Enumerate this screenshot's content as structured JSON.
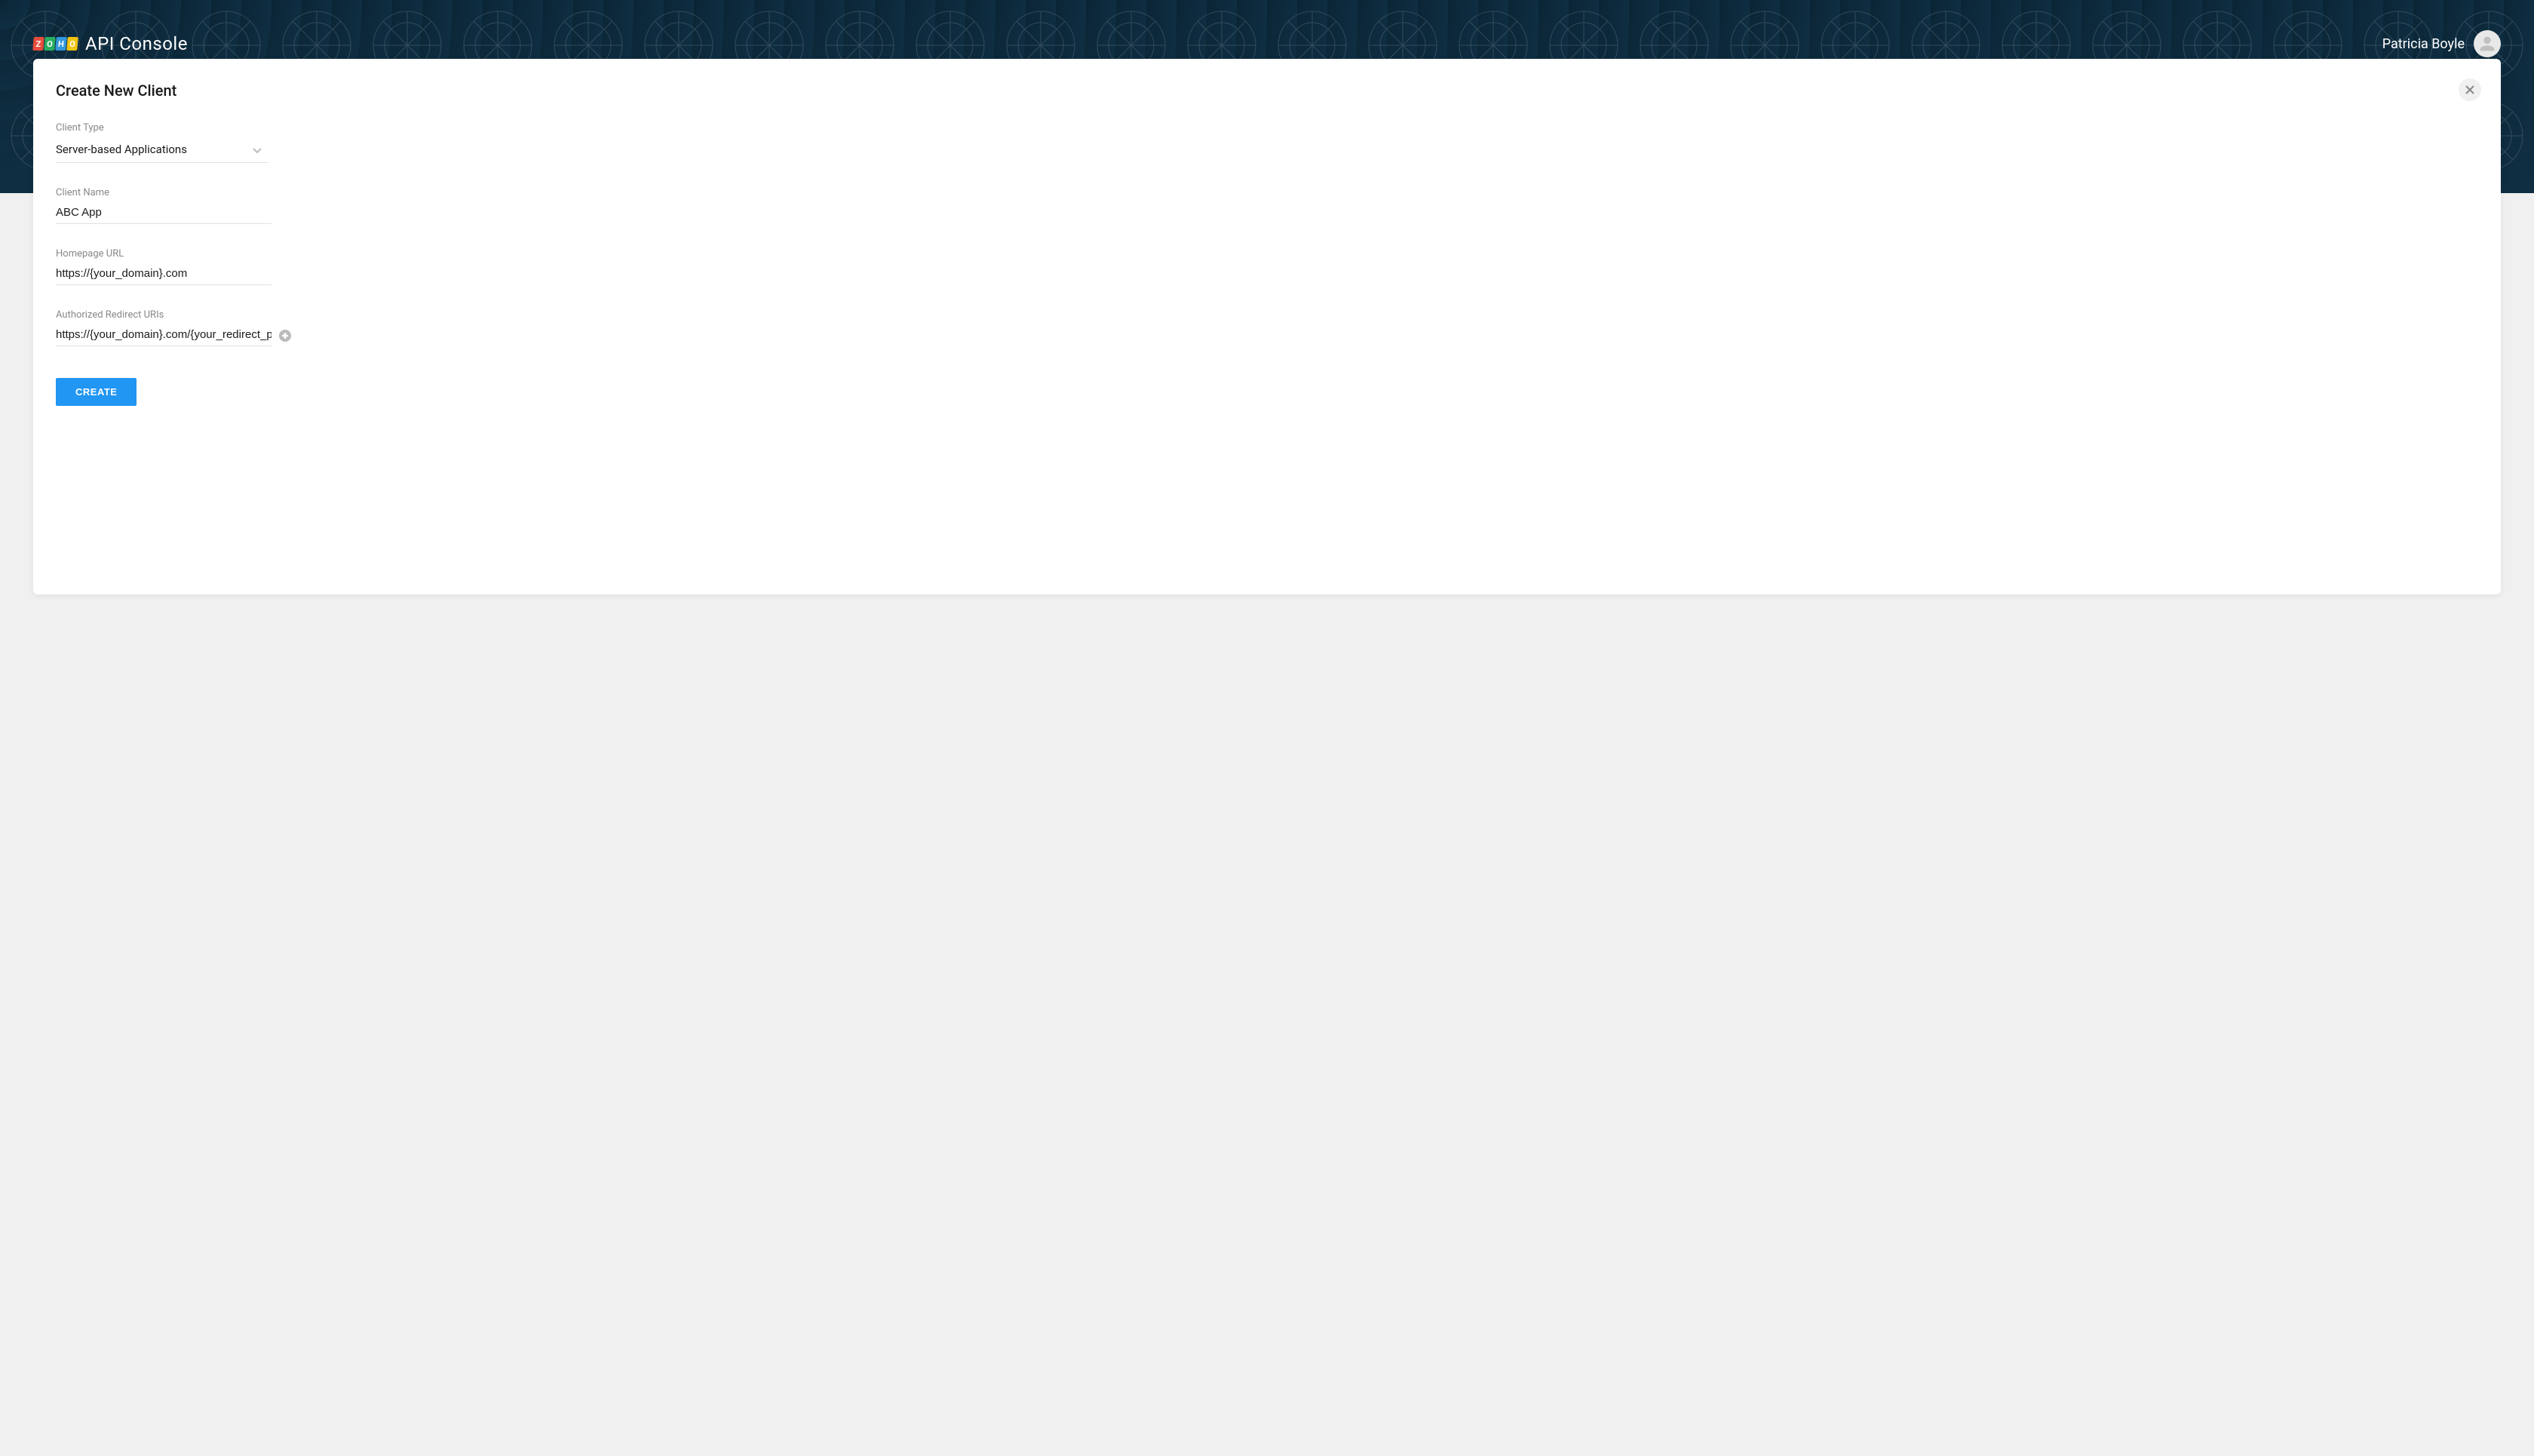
{
  "header": {
    "product_name": "API Console",
    "user_name": "Patricia Boyle"
  },
  "card": {
    "title": "Create New Client"
  },
  "form": {
    "client_type": {
      "label": "Client Type",
      "value": "Server-based Applications"
    },
    "client_name": {
      "label": "Client Name",
      "value": "ABC App"
    },
    "homepage_url": {
      "label": "Homepage URL",
      "value": "https://{your_domain}.com"
    },
    "redirect_uris": {
      "label": "Authorized Redirect URIs",
      "value": "https://{your_domain}.com/{your_redirect_page}"
    },
    "submit_label": "CREATE"
  }
}
